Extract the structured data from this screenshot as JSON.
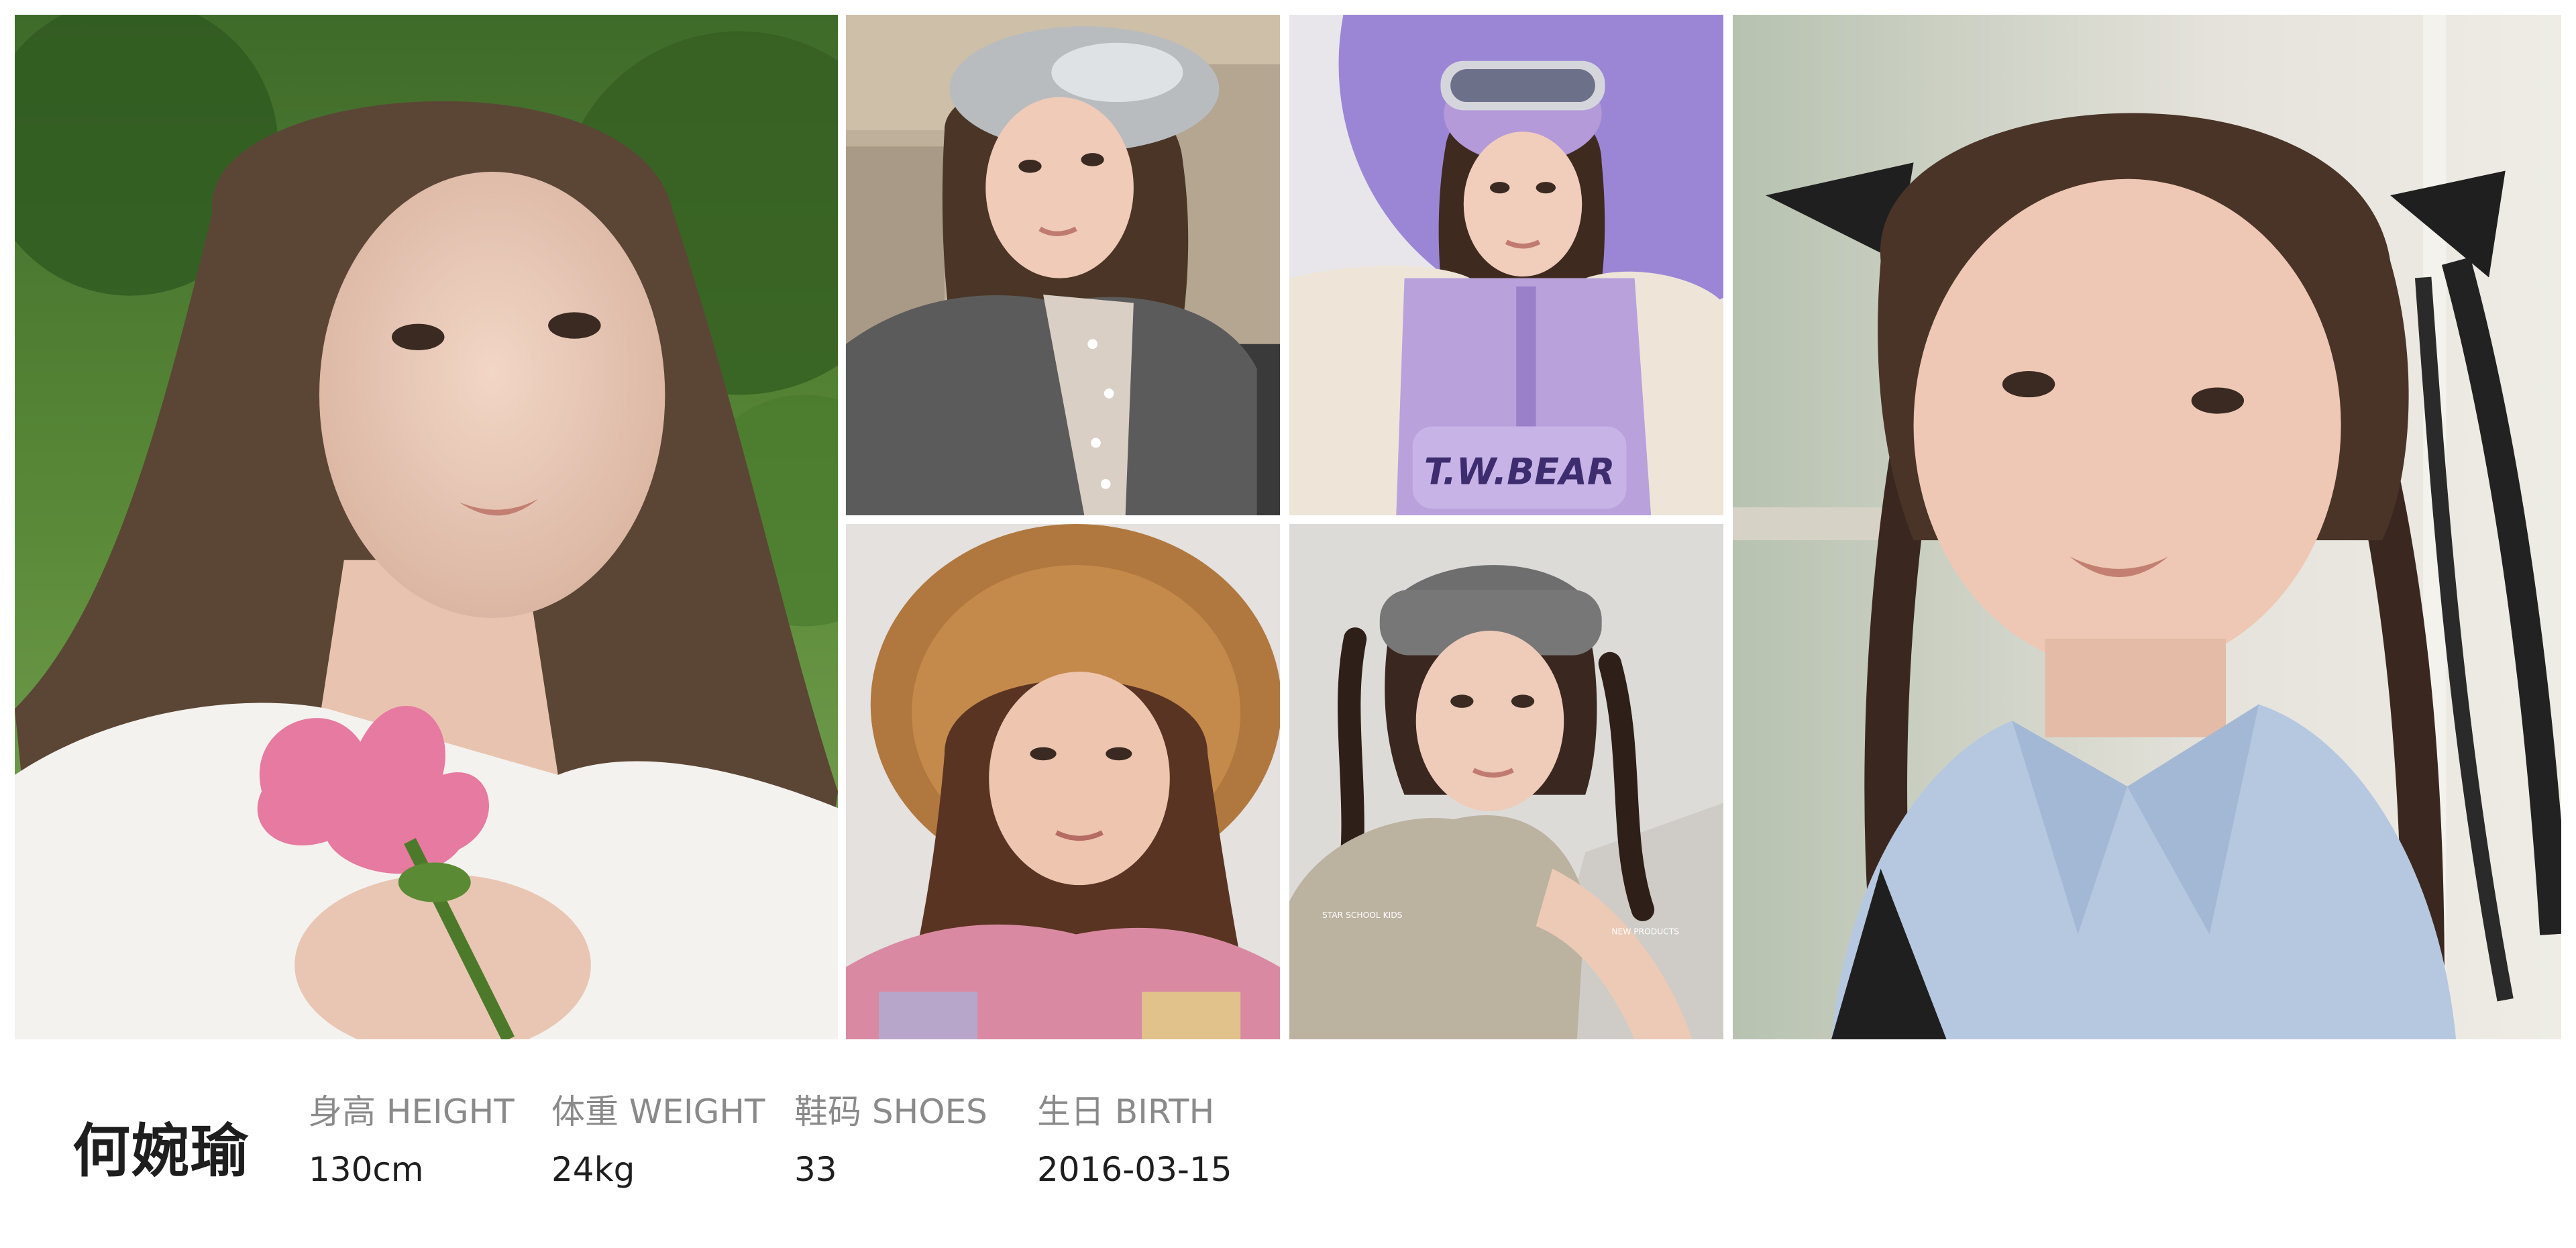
{
  "profile": {
    "name": "何婉瑜"
  },
  "stats": {
    "height": {
      "label": "身高 HEIGHT",
      "value": "130cm"
    },
    "weight": {
      "label": "体重 WEIGHT",
      "value": "24kg"
    },
    "shoes": {
      "label": "鞋码 SHOES",
      "value": "33"
    },
    "birth": {
      "label": "生日 BIRTH",
      "value": "2016-03-15"
    }
  },
  "photos": {
    "photo3": {
      "print": "T.W.BEAR"
    },
    "photo5": {
      "print_left": "STAR SCHOOL KIDS",
      "print_right": "NEW PRODUCTS"
    }
  },
  "colors": {
    "name_text": "#1e1e1e",
    "label_text": "#8a8a8a",
    "value_text": "#1e1e1e",
    "background": "#ffffff"
  }
}
